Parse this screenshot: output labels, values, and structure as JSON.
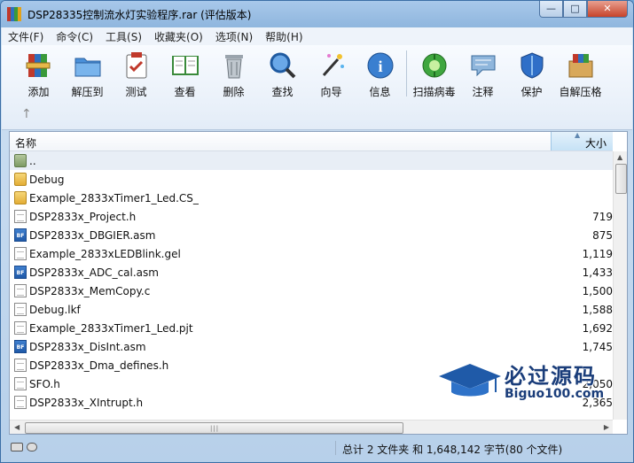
{
  "window": {
    "title": "DSP28335控制流水灯实验程序.rar (评估版本)",
    "buttons": {
      "minimize": "—",
      "maximize": "□",
      "close": "✕"
    }
  },
  "menu": [
    "文件(F)",
    "命令(C)",
    "工具(S)",
    "收藏夹(O)",
    "选项(N)",
    "帮助(H)"
  ],
  "toolbar": {
    "tools": [
      {
        "label": "添加",
        "icon": "add-archive-icon"
      },
      {
        "label": "解压到",
        "icon": "extract-folder-icon"
      },
      {
        "label": "测试",
        "icon": "test-clipboard-icon"
      },
      {
        "label": "查看",
        "icon": "view-book-icon"
      },
      {
        "label": "删除",
        "icon": "trash-icon"
      },
      {
        "label": "查找",
        "icon": "find-magnifier-icon"
      },
      {
        "label": "向导",
        "icon": "wizard-wand-icon"
      },
      {
        "label": "信息",
        "icon": "info-icon"
      },
      {
        "label": "扫描病毒",
        "icon": "virus-scan-icon"
      },
      {
        "label": "注释",
        "icon": "comment-icon"
      },
      {
        "label": "保护",
        "icon": "shield-icon"
      },
      {
        "label": "自解压格",
        "icon": "sfx-box-icon"
      }
    ],
    "up_arrow": "↑"
  },
  "filelist": {
    "columns": {
      "name": "名称",
      "size": "大小"
    },
    "rows": [
      {
        "name": "..",
        "size": "",
        "type": "updir"
      },
      {
        "name": "Debug",
        "size": "",
        "type": "folder"
      },
      {
        "name": "Example_2833xTimer1_Led.CS_",
        "size": "",
        "type": "folder"
      },
      {
        "name": "DSP2833x_Project.h",
        "size": "719",
        "type": "file"
      },
      {
        "name": "DSP2833x_DBGIER.asm",
        "size": "875",
        "type": "asm"
      },
      {
        "name": "Example_2833xLEDBlink.gel",
        "size": "1,119",
        "type": "file"
      },
      {
        "name": "DSP2833x_ADC_cal.asm",
        "size": "1,433",
        "type": "asm"
      },
      {
        "name": "DSP2833x_MemCopy.c",
        "size": "1,500",
        "type": "file"
      },
      {
        "name": "Debug.lkf",
        "size": "1,588",
        "type": "file"
      },
      {
        "name": "Example_2833xTimer1_Led.pjt",
        "size": "1,692",
        "type": "file"
      },
      {
        "name": "DSP2833x_DisInt.asm",
        "size": "1,745",
        "type": "asm"
      },
      {
        "name": "DSP2833x_Dma_defines.h",
        "size": "",
        "type": "file"
      },
      {
        "name": "SFO.h",
        "size": "2,050",
        "type": "file"
      },
      {
        "name": "DSP2833x_XIntrupt.h",
        "size": "2,365",
        "type": "file"
      }
    ]
  },
  "status": {
    "text": "总计 2 文件夹 和 1,648,142 字节(80 个文件)"
  },
  "watermark": {
    "title": "必过源码",
    "sub": "Biguo100.com"
  }
}
